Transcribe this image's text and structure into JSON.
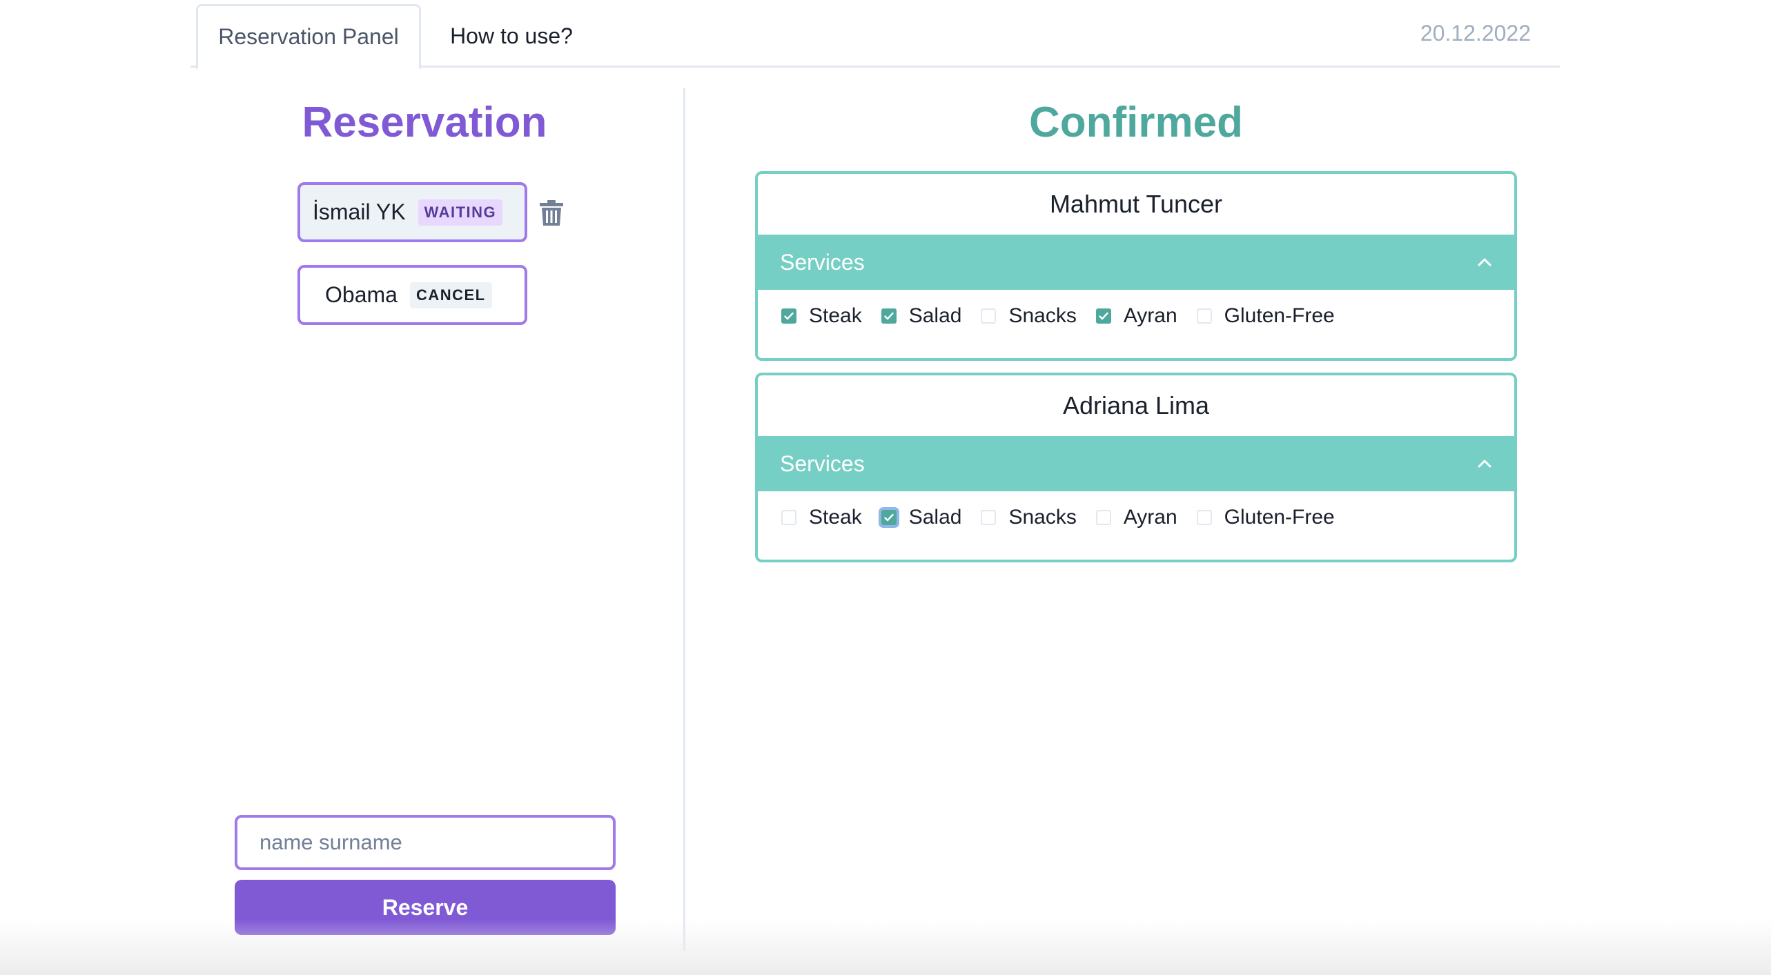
{
  "tabs": {
    "active": "Reservation Panel",
    "other": "How to use?"
  },
  "date": "20.12.2022",
  "reservation": {
    "title": "Reservation",
    "items": [
      {
        "name": "İsmail YK",
        "status": "WAITING"
      },
      {
        "name": "Obama",
        "status": "CANCEL"
      }
    ],
    "input_placeholder": "name surname",
    "input_value": "",
    "button_label": "Reserve"
  },
  "confirmed": {
    "title": "Confirmed",
    "cards": [
      {
        "name": "Mahmut Tuncer",
        "services_label": "Services",
        "options": [
          {
            "label": "Steak",
            "checked": true
          },
          {
            "label": "Salad",
            "checked": true
          },
          {
            "label": "Snacks",
            "checked": false
          },
          {
            "label": "Ayran",
            "checked": true
          },
          {
            "label": "Gluten-Free",
            "checked": false
          }
        ]
      },
      {
        "name": "Adriana Lima",
        "services_label": "Services",
        "options": [
          {
            "label": "Steak",
            "checked": false
          },
          {
            "label": "Salad",
            "checked": true
          },
          {
            "label": "Snacks",
            "checked": false
          },
          {
            "label": "Ayran",
            "checked": false
          },
          {
            "label": "Gluten-Free",
            "checked": false
          }
        ]
      }
    ]
  },
  "colors": {
    "purple_accent": "#805ad5",
    "teal_accent": "#76cfc4",
    "teal_title": "#4fa89d"
  },
  "icons": {
    "delete": "trash-icon",
    "collapse": "chevron-up-icon",
    "check": "check-icon"
  }
}
